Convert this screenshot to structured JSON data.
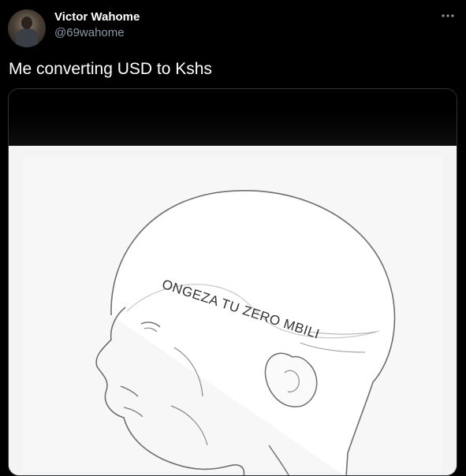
{
  "tweet": {
    "display_name": "Victor Wahome",
    "handle": "@69wahome",
    "text": "Me converting USD to Kshs",
    "more_icon": "more-horizontal-icon",
    "avatar_icon": "avatar-photo"
  },
  "media": {
    "meme_caption": "ONGEZA TU ZERO MBILI"
  },
  "colors": {
    "background": "#000000",
    "name": "#ffffff",
    "handle": "#8b98a5",
    "media_border": "#2f3336"
  }
}
